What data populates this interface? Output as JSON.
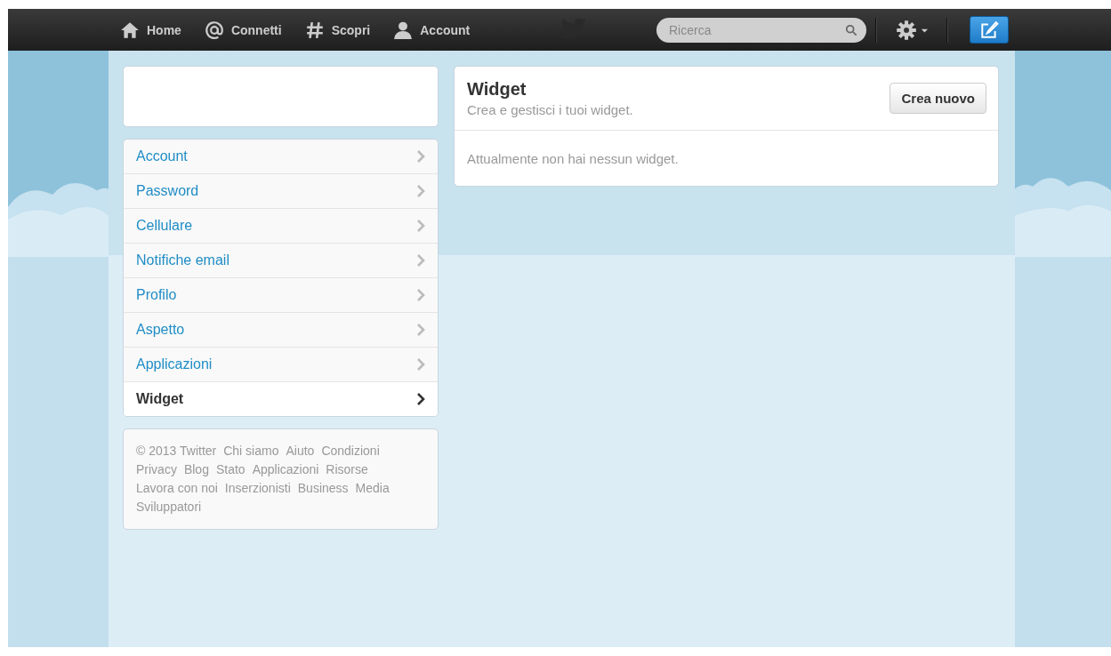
{
  "topbar": {
    "nav": [
      {
        "kind": "home",
        "label": "Home"
      },
      {
        "kind": "at",
        "label": "Connetti"
      },
      {
        "kind": "hash",
        "label": "Scopri"
      },
      {
        "kind": "person",
        "label": "Account"
      }
    ],
    "search": {
      "placeholder": "Ricerca"
    }
  },
  "sidebar": {
    "items": [
      {
        "label": "Account",
        "selected": false
      },
      {
        "label": "Password",
        "selected": false
      },
      {
        "label": "Cellulare",
        "selected": false
      },
      {
        "label": "Notifiche email",
        "selected": false
      },
      {
        "label": "Profilo",
        "selected": false
      },
      {
        "label": "Aspetto",
        "selected": false
      },
      {
        "label": "Applicazioni",
        "selected": false
      },
      {
        "label": "Widget",
        "selected": true
      }
    ]
  },
  "footer": {
    "copyright": "© 2013 Twitter",
    "links": [
      "Chi siamo",
      "Aiuto",
      "Condizioni",
      "Privacy",
      "Blog",
      "Stato",
      "Applicazioni",
      "Risorse",
      "Lavora con noi",
      "Inserzionisti",
      "Business",
      "Media",
      "Sviluppatori"
    ]
  },
  "content": {
    "title": "Widget",
    "subtitle": "Crea e gestisci i tuoi widget.",
    "button": "Crea nuovo",
    "empty_message": "Attualmente non hai nessun widget."
  }
}
